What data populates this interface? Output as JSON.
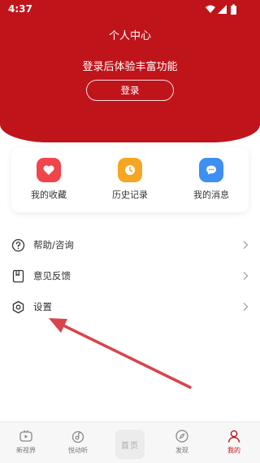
{
  "status_bar": {
    "time": "4:37"
  },
  "header": {
    "title": "个人中心",
    "promo_text": "登录后体验丰富功能",
    "login_label": "登录"
  },
  "quick_actions": [
    {
      "label": "我的收藏",
      "icon": "heart-icon",
      "color": "#f0454a"
    },
    {
      "label": "历史记录",
      "icon": "clock-icon",
      "color": "#f5a623"
    },
    {
      "label": "我的消息",
      "icon": "chat-icon",
      "color": "#3d8ff2"
    }
  ],
  "menu": [
    {
      "label": "帮助/咨询",
      "icon": "help-icon"
    },
    {
      "label": "意见反馈",
      "icon": "feedback-icon"
    },
    {
      "label": "设置",
      "icon": "settings-icon"
    }
  ],
  "tab_bar": {
    "items": [
      {
        "label": "新视界",
        "icon": "video-icon"
      },
      {
        "label": "悦动听",
        "icon": "music-icon"
      },
      {
        "label": "首页",
        "icon": "home-logo"
      },
      {
        "label": "发现",
        "icon": "compass-icon"
      },
      {
        "label": "我的",
        "icon": "user-icon"
      }
    ],
    "active": "我的"
  },
  "colors": {
    "brand": "#c0141b",
    "annotation_arrow": "#d9434b"
  }
}
